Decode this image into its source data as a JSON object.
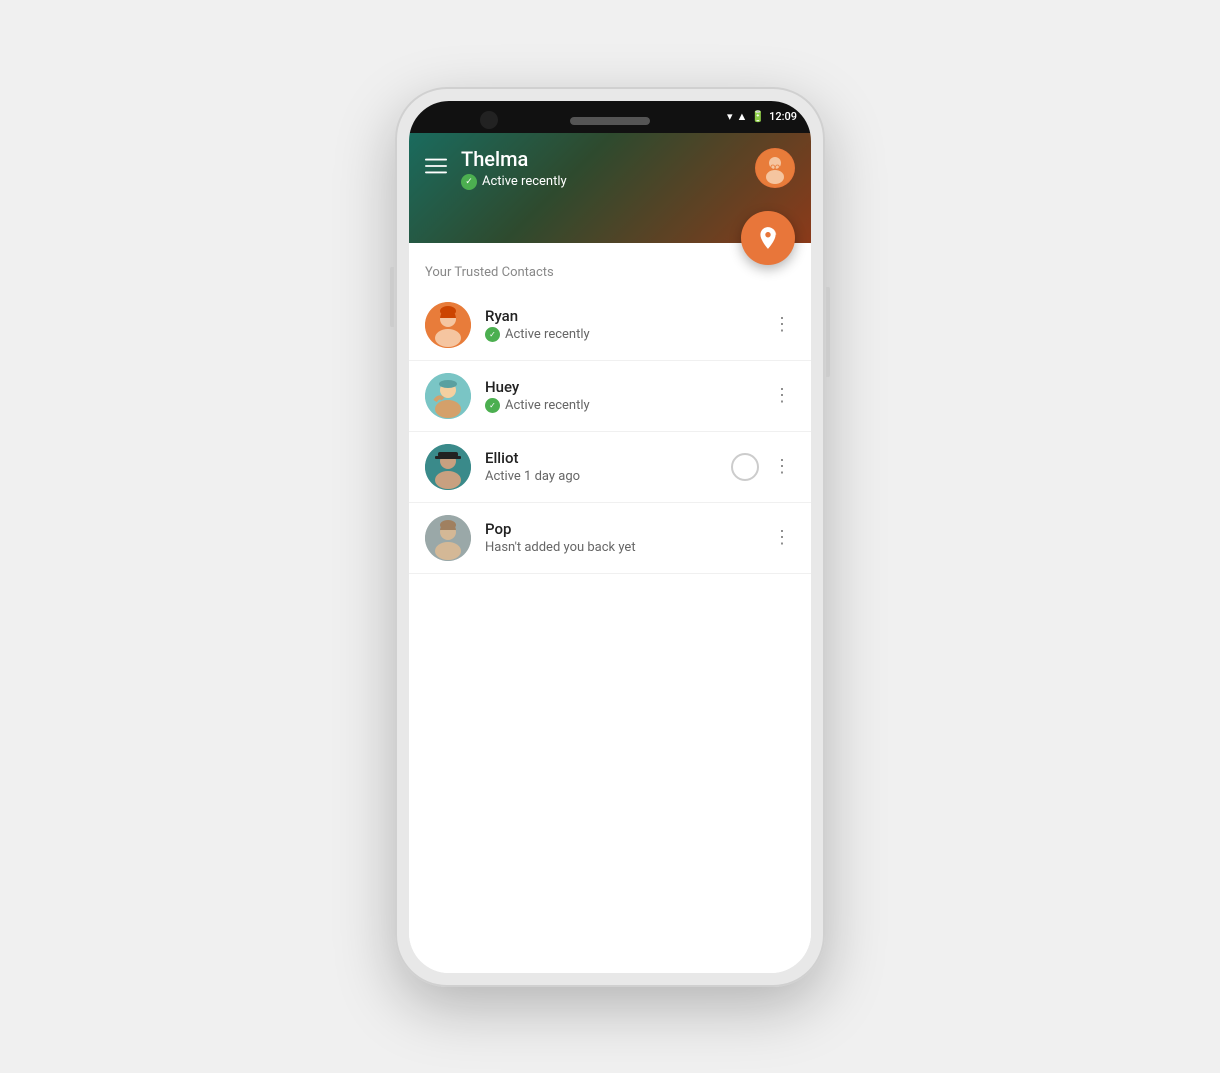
{
  "phone": {
    "status_bar": {
      "time": "12:09"
    },
    "header": {
      "title": "Thelma",
      "status": "Active recently",
      "menu_label": "Menu"
    },
    "section_label": "Your Trusted Contacts",
    "contacts": [
      {
        "id": "ryan",
        "name": "Ryan",
        "status_text": "Active recently",
        "status_type": "active",
        "avatar_color": "#e87c3a",
        "avatar_label": "Ryan avatar"
      },
      {
        "id": "huey",
        "name": "Huey",
        "status_text": "Active recently",
        "status_type": "active",
        "avatar_color": "#7ac5c5",
        "avatar_label": "Huey avatar"
      },
      {
        "id": "elliot",
        "name": "Elliot",
        "status_text": "Active 1 day ago",
        "status_type": "inactive",
        "avatar_color": "#3a8a8a",
        "avatar_label": "Elliot avatar"
      },
      {
        "id": "pop",
        "name": "Pop",
        "status_text": "Hasn't added you back yet",
        "status_type": "pending",
        "avatar_color": "#9aa8a8",
        "avatar_label": "Pop avatar"
      }
    ],
    "fab": {
      "label": "Share location"
    }
  }
}
